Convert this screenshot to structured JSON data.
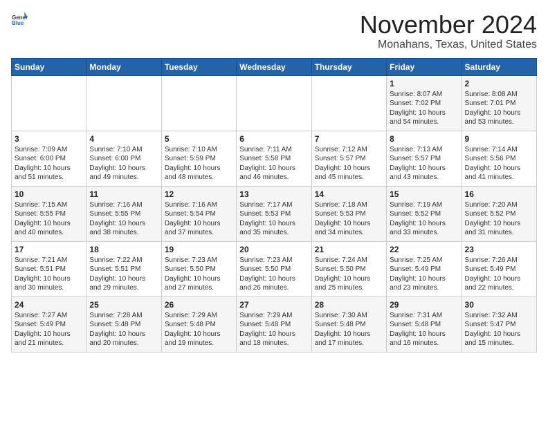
{
  "header": {
    "logo_general": "General",
    "logo_blue": "Blue",
    "month": "November 2024",
    "location": "Monahans, Texas, United States"
  },
  "weekdays": [
    "Sunday",
    "Monday",
    "Tuesday",
    "Wednesday",
    "Thursday",
    "Friday",
    "Saturday"
  ],
  "weeks": [
    [
      {
        "day": "",
        "info": ""
      },
      {
        "day": "",
        "info": ""
      },
      {
        "day": "",
        "info": ""
      },
      {
        "day": "",
        "info": ""
      },
      {
        "day": "",
        "info": ""
      },
      {
        "day": "1",
        "info": "Sunrise: 8:07 AM\nSunset: 7:02 PM\nDaylight: 10 hours\nand 54 minutes."
      },
      {
        "day": "2",
        "info": "Sunrise: 8:08 AM\nSunset: 7:01 PM\nDaylight: 10 hours\nand 53 minutes."
      }
    ],
    [
      {
        "day": "3",
        "info": "Sunrise: 7:09 AM\nSunset: 6:00 PM\nDaylight: 10 hours\nand 51 minutes."
      },
      {
        "day": "4",
        "info": "Sunrise: 7:10 AM\nSunset: 6:00 PM\nDaylight: 10 hours\nand 49 minutes."
      },
      {
        "day": "5",
        "info": "Sunrise: 7:10 AM\nSunset: 5:59 PM\nDaylight: 10 hours\nand 48 minutes."
      },
      {
        "day": "6",
        "info": "Sunrise: 7:11 AM\nSunset: 5:58 PM\nDaylight: 10 hours\nand 46 minutes."
      },
      {
        "day": "7",
        "info": "Sunrise: 7:12 AM\nSunset: 5:57 PM\nDaylight: 10 hours\nand 45 minutes."
      },
      {
        "day": "8",
        "info": "Sunrise: 7:13 AM\nSunset: 5:57 PM\nDaylight: 10 hours\nand 43 minutes."
      },
      {
        "day": "9",
        "info": "Sunrise: 7:14 AM\nSunset: 5:56 PM\nDaylight: 10 hours\nand 41 minutes."
      }
    ],
    [
      {
        "day": "10",
        "info": "Sunrise: 7:15 AM\nSunset: 5:55 PM\nDaylight: 10 hours\nand 40 minutes."
      },
      {
        "day": "11",
        "info": "Sunrise: 7:16 AM\nSunset: 5:55 PM\nDaylight: 10 hours\nand 38 minutes."
      },
      {
        "day": "12",
        "info": "Sunrise: 7:16 AM\nSunset: 5:54 PM\nDaylight: 10 hours\nand 37 minutes."
      },
      {
        "day": "13",
        "info": "Sunrise: 7:17 AM\nSunset: 5:53 PM\nDaylight: 10 hours\nand 35 minutes."
      },
      {
        "day": "14",
        "info": "Sunrise: 7:18 AM\nSunset: 5:53 PM\nDaylight: 10 hours\nand 34 minutes."
      },
      {
        "day": "15",
        "info": "Sunrise: 7:19 AM\nSunset: 5:52 PM\nDaylight: 10 hours\nand 33 minutes."
      },
      {
        "day": "16",
        "info": "Sunrise: 7:20 AM\nSunset: 5:52 PM\nDaylight: 10 hours\nand 31 minutes."
      }
    ],
    [
      {
        "day": "17",
        "info": "Sunrise: 7:21 AM\nSunset: 5:51 PM\nDaylight: 10 hours\nand 30 minutes."
      },
      {
        "day": "18",
        "info": "Sunrise: 7:22 AM\nSunset: 5:51 PM\nDaylight: 10 hours\nand 29 minutes."
      },
      {
        "day": "19",
        "info": "Sunrise: 7:23 AM\nSunset: 5:50 PM\nDaylight: 10 hours\nand 27 minutes."
      },
      {
        "day": "20",
        "info": "Sunrise: 7:23 AM\nSunset: 5:50 PM\nDaylight: 10 hours\nand 26 minutes."
      },
      {
        "day": "21",
        "info": "Sunrise: 7:24 AM\nSunset: 5:50 PM\nDaylight: 10 hours\nand 25 minutes."
      },
      {
        "day": "22",
        "info": "Sunrise: 7:25 AM\nSunset: 5:49 PM\nDaylight: 10 hours\nand 23 minutes."
      },
      {
        "day": "23",
        "info": "Sunrise: 7:26 AM\nSunset: 5:49 PM\nDaylight: 10 hours\nand 22 minutes."
      }
    ],
    [
      {
        "day": "24",
        "info": "Sunrise: 7:27 AM\nSunset: 5:49 PM\nDaylight: 10 hours\nand 21 minutes."
      },
      {
        "day": "25",
        "info": "Sunrise: 7:28 AM\nSunset: 5:48 PM\nDaylight: 10 hours\nand 20 minutes."
      },
      {
        "day": "26",
        "info": "Sunrise: 7:29 AM\nSunset: 5:48 PM\nDaylight: 10 hours\nand 19 minutes."
      },
      {
        "day": "27",
        "info": "Sunrise: 7:29 AM\nSunset: 5:48 PM\nDaylight: 10 hours\nand 18 minutes."
      },
      {
        "day": "28",
        "info": "Sunrise: 7:30 AM\nSunset: 5:48 PM\nDaylight: 10 hours\nand 17 minutes."
      },
      {
        "day": "29",
        "info": "Sunrise: 7:31 AM\nSunset: 5:48 PM\nDaylight: 10 hours\nand 16 minutes."
      },
      {
        "day": "30",
        "info": "Sunrise: 7:32 AM\nSunset: 5:47 PM\nDaylight: 10 hours\nand 15 minutes."
      }
    ]
  ]
}
